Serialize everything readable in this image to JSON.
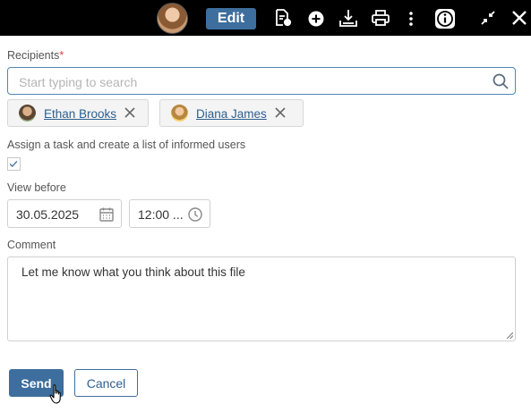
{
  "toolbar": {
    "edit_label": "Edit",
    "icons": [
      "document-settings-icon",
      "add-icon",
      "download-icon",
      "print-icon",
      "more-vertical-icon",
      "info-icon",
      "collapse-icon",
      "close-icon"
    ]
  },
  "form": {
    "recipients_label": "Recipients",
    "required_mark": "*",
    "search_placeholder": "Start typing to search",
    "recipients": [
      {
        "name": "Ethan Brooks"
      },
      {
        "name": "Diana James"
      }
    ],
    "assign_label": "Assign a task and create a list of informed users",
    "assign_checked": true,
    "view_before_label": "View before",
    "date_value": "30.05.2025",
    "time_value": "12:00 ...",
    "comment_label": "Comment",
    "comment_value": "Let me know what you think about this file",
    "send_label": "Send",
    "cancel_label": "Cancel"
  },
  "colors": {
    "accent": "#3d6e9d",
    "link": "#2d5f8f",
    "required": "#e03b3b",
    "topbar": "#000000"
  }
}
